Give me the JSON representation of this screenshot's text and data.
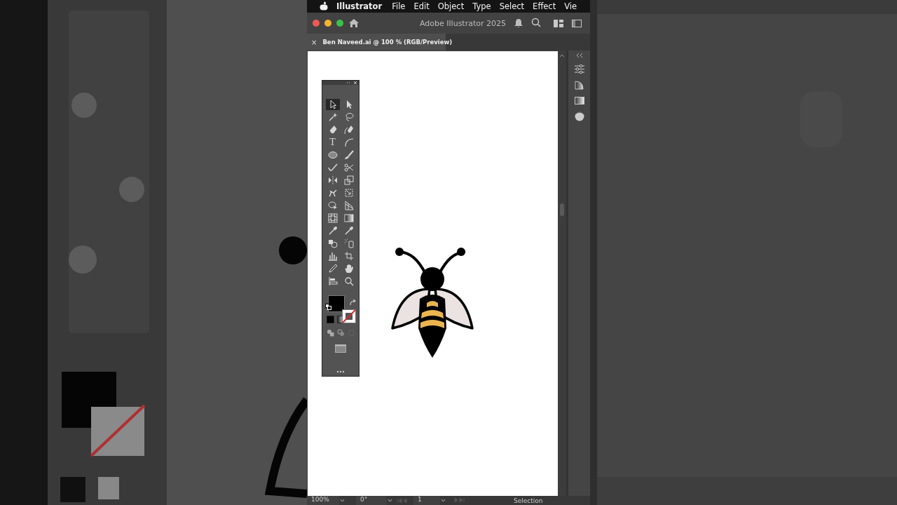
{
  "menu_bar": {
    "app": "Illustrator",
    "items": [
      "File",
      "Edit",
      "Object",
      "Type",
      "Select",
      "Effect",
      "Vie"
    ]
  },
  "window": {
    "title": "Adobe Illustrator 2025"
  },
  "document_tab": {
    "close": "×",
    "label": "Ben Naveed.ai @ 100 % (RGB/Preview)"
  },
  "tools": [
    {
      "kind": "selection",
      "selected": true
    },
    {
      "kind": "direct",
      "selected": false
    },
    {
      "kind": "wand",
      "selected": false
    },
    {
      "kind": "lasso",
      "selected": false
    },
    {
      "kind": "pen",
      "selected": false
    },
    {
      "kind": "curvature",
      "selected": false
    },
    {
      "kind": "type",
      "label": "T",
      "selected": false
    },
    {
      "kind": "arc",
      "selected": false
    },
    {
      "kind": "ellipse",
      "selected": false
    },
    {
      "kind": "brush",
      "selected": false
    },
    {
      "kind": "shaper",
      "selected": false
    },
    {
      "kind": "scissors",
      "selected": false
    },
    {
      "kind": "reflect",
      "selected": false
    },
    {
      "kind": "scale",
      "selected": false
    },
    {
      "kind": "puppet",
      "selected": false
    },
    {
      "kind": "transform",
      "selected": false
    },
    {
      "kind": "shapebuilder",
      "selected": false
    },
    {
      "kind": "perspective",
      "selected": false
    },
    {
      "kind": "mesh",
      "selected": false
    },
    {
      "kind": "gradient",
      "selected": false
    },
    {
      "kind": "dropper",
      "selected": false
    },
    {
      "kind": "dropper",
      "selected": false
    },
    {
      "kind": "blend",
      "selected": false
    },
    {
      "kind": "symbol",
      "selected": false
    },
    {
      "kind": "chart",
      "selected": false
    },
    {
      "kind": "artboard",
      "selected": false
    },
    {
      "kind": "pencil",
      "selected": false
    },
    {
      "kind": "hand",
      "selected": false
    },
    {
      "kind": "align",
      "selected": false
    },
    {
      "kind": "zoom",
      "selected": false
    }
  ],
  "status_bar": {
    "zoom": "100%",
    "rotation": "0°",
    "artboard": "1",
    "tool": "Selection"
  }
}
